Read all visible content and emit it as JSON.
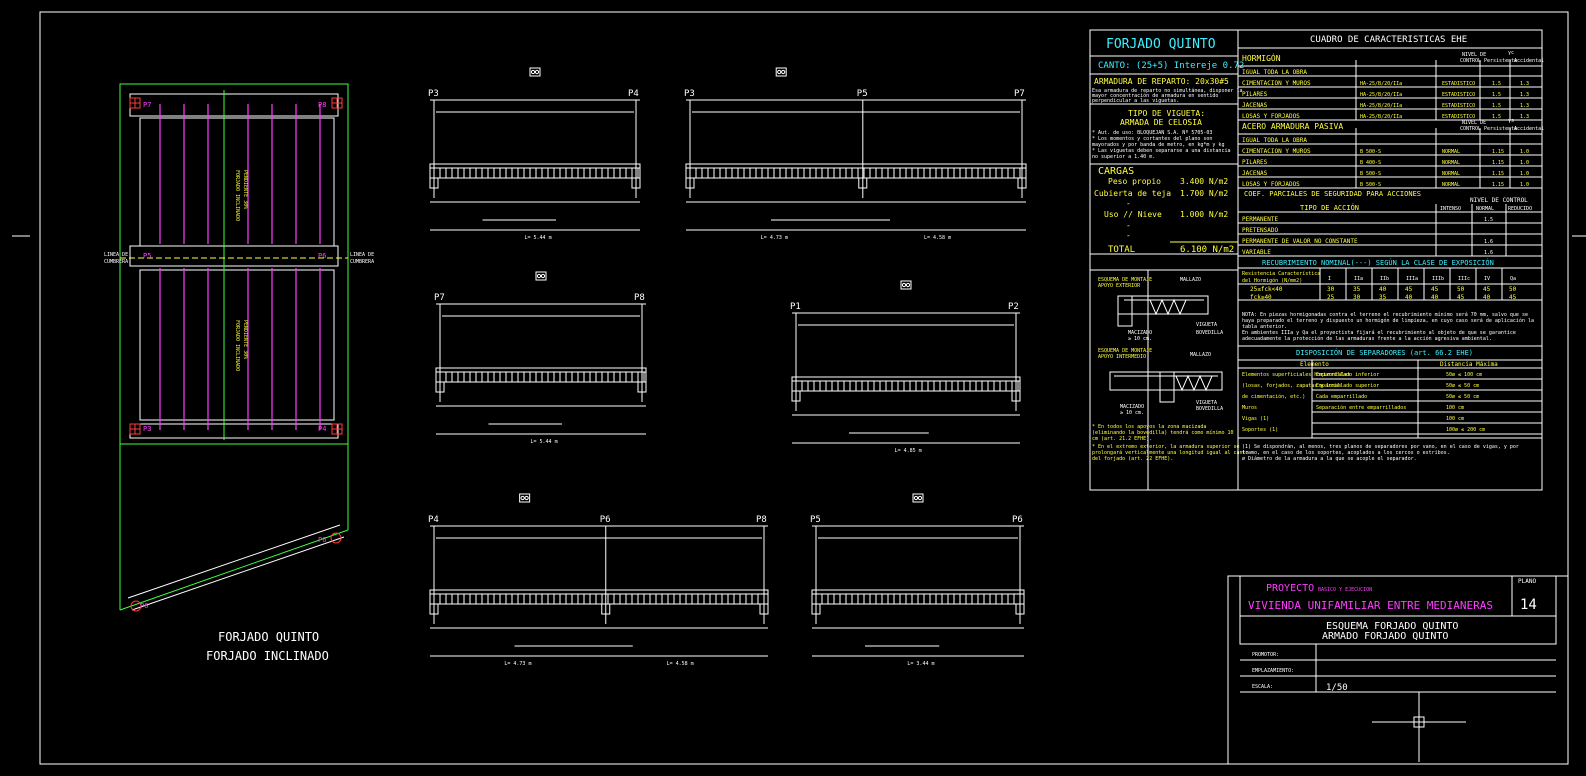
{
  "colors": {
    "background": "#000000",
    "frame": "#ffffff",
    "text_yellow": "#ffff3c",
    "text_cyan": "#3cf0ff",
    "text_magenta": "#ff3cff",
    "rebar": "#ff3cff",
    "outline": "#3cff3c",
    "marker": "#ff3c3c"
  },
  "plan": {
    "pillars": {
      "p7": "P7",
      "p8": "P8",
      "p5": "P5",
      "p6": "P6",
      "p3": "P3",
      "p4": "P4",
      "p6b": "P6",
      "p6c": "P6"
    },
    "side_left_top": "LINEA DE",
    "side_left_bottom": "CUMBRERA",
    "side_right_top": "LINEA DE",
    "side_right_bottom": "CUMBRERA",
    "label_top_bay": "FORJADO INCLINADO",
    "label_top_bay2": "PENDIENTE 30%",
    "label_bottom_bay": "FORJADO INCLINADO",
    "label_bottom_bay2": "PENDIENTE 30%",
    "title_line1": "FORJADO QUINTO",
    "title_line2": "FORJADO INCLINADO"
  },
  "beams": [
    {
      "id": "beam-p3-p4",
      "left": "P3",
      "right": "P4",
      "length": "L= 5.44 m"
    },
    {
      "id": "beam-p3-p5-p7",
      "left": "P3",
      "mid": "P5",
      "right": "P7",
      "length1": "L= 4.73 m",
      "length2": "L= 4.58 m"
    },
    {
      "id": "beam-p7-p8",
      "left": "P7",
      "right": "P8",
      "length": "L= 5.44 m"
    },
    {
      "id": "beam-p1-p2",
      "left": "P1",
      "right": "P2",
      "length": "L= 4.85 m"
    },
    {
      "id": "beam-p4-p6-p8",
      "left": "P4",
      "mid": "P6",
      "right": "P8",
      "length1": "L= 4.73 m",
      "length2": "L= 4.58 m"
    },
    {
      "id": "beam-p5-p6",
      "left": "P5",
      "right": "P6",
      "length": "L= 3.44 m"
    }
  ],
  "spec": {
    "title": "FORJADO QUINTO",
    "canto": "CANTO: (25+5) Intereje 0.72",
    "armadura": "ARMADURA DE REPARTO: 20x30#5",
    "armadura_note1": "Esa armadura de reparto no simultánea, disponer la",
    "armadura_note2": "mayor concentración de armadura en sentido",
    "armadura_note3": "perpendicular a las viguetas.",
    "vigueta_title1": "TIPO DE VIGUETA:",
    "vigueta_title2": "ARMADA DE CELOSIA",
    "vigueta_note1": "* Aut. de uso: BLOQUEJAN S.A. Nº 5705-03",
    "vigueta_note2": "* Los momentos y cortantes del plano son",
    "vigueta_note3": "mayorados y por banda de metro, en kg*m y kg",
    "vigueta_note4": "* Las viguetas deben separarse a una distancia",
    "vigueta_note5": "no superior a 1.40 m.",
    "cargas_title": "CARGAS",
    "cargas": [
      {
        "label": "Peso propio",
        "value": "3.400 N/m2"
      },
      {
        "label": "Cubierta de teja",
        "value": "1.700 N/m2"
      },
      {
        "label": "Uso // Nieve",
        "value": "1.000 N/m2"
      }
    ],
    "dash": "-",
    "total_label": "TOTAL",
    "total_value": "6.100 N/m2",
    "detail1_l1": "ESQUEMA DE MONTAJE",
    "detail1_l2": "APOYO EXTERIOR",
    "detail2_l1": "ESQUEMA DE MONTAJE",
    "detail2_l2": "APOYO INTERMEDIO",
    "detail_mallazo": "MALLAZO",
    "detail_vigueta": "VIGUETA",
    "detail_bovedilla": "BOVEDILLA",
    "detail_macizado": "MACIZADO",
    "detail_macizado_dim": "≥ 10 cm.",
    "detail_note1": "* En todos los apoyos la zona macizada",
    "detail_note2": "(eliminando la bovedilla) tendrá como mínimo 10",
    "detail_note3": "cm (art. 21.2 EFHE).",
    "detail_note4": "* En el extremo exterior, la armadura superior se",
    "detail_note5": "prolongará verticalmente una longitud igual al canto",
    "detail_note6": "del forjado (art. 22 EFHE)."
  },
  "characteristics": {
    "title": "CUADRO DE CARACTERISTICAS  EHE",
    "hormigon": "HORMIGÓN",
    "nivel": "NIVEL DE",
    "control": "CONTROL",
    "gamma": "γc",
    "persistente": "Persistente",
    "accidental": "Accidental",
    "igual_toda_obra": "IGUAL TODA LA OBRA",
    "horm_rows": [
      {
        "el": "CIMENTACION Y MUROS",
        "tipo": "HA-25/B/20/IIa",
        "nivel": "ESTADISTICO",
        "p": "1.5",
        "a": "1.3"
      },
      {
        "el": "PILARES",
        "tipo": "HA-25/B/20/IIa",
        "nivel": "ESTADISTICO",
        "p": "1.5",
        "a": "1.3"
      },
      {
        "el": "JACENAS",
        "tipo": "HA-25/B/20/IIa",
        "nivel": "ESTADISTICO",
        "p": "1.5",
        "a": "1.3"
      },
      {
        "el": "LOSAS Y FORJADOS",
        "tipo": "HA-25/B/20/IIa",
        "nivel": "ESTADISTICO",
        "p": "1.5",
        "a": "1.3"
      }
    ],
    "acero": "ACERO ARMADURA PASIVA",
    "gamma_s": "γs",
    "acero_rows": [
      {
        "el": "CIMENTACION Y MUROS",
        "tipo": "B 500-S",
        "nivel": "NORMAL",
        "p": "1.15",
        "a": "1.0"
      },
      {
        "el": "PILARES",
        "tipo": "B 400-S",
        "nivel": "NORMAL",
        "p": "1.15",
        "a": "1.0"
      },
      {
        "el": "JACENAS",
        "tipo": "B 500-S",
        "nivel": "NORMAL",
        "p": "1.15",
        "a": "1.0"
      },
      {
        "el": "LOSAS Y FORJADOS",
        "tipo": "B 500-S",
        "nivel": "NORMAL",
        "p": "1.15",
        "a": "1.0"
      }
    ],
    "coef_title": "COEF. PARCIALES DE SEGURIDAD PARA ACCIONES",
    "nivel_control": "NIVEL DE CONTROL",
    "tipo_accion": "TIPO DE ACCIÓN",
    "intenso": "INTENSO",
    "normal": "NORMAL",
    "reducido": "REDUCIDO",
    "acciones": [
      {
        "t": "PERMANENTE",
        "n": "1.5"
      },
      {
        "t": "PRETENSADO",
        "n": ""
      },
      {
        "t": "PERMANENTE DE VALOR NO CONSTANTE",
        "n": "1.6"
      },
      {
        "t": "VARIABLE",
        "n": "1.6"
      }
    ],
    "recub_title": "RECUBRIMIENTO NOMINAL(---) SEGÚN LA CLASE DE EXPOSICIÓN",
    "recub_h1": "Resistencia Característica",
    "recub_h2": "del Hormigón (N/mm2)",
    "recub_cols": [
      "I",
      "IIa",
      "IIb",
      "IIIa",
      "IIIb",
      "IIIc",
      "IV",
      "Qa"
    ],
    "recub_rows": [
      {
        "r": "25≤fck<40",
        "v": [
          "30",
          "35",
          "40",
          "45",
          "45",
          "50",
          "45",
          "50"
        ]
      },
      {
        "r": "fck≥40",
        "v": [
          "25",
          "30",
          "35",
          "40",
          "40",
          "45",
          "40",
          "45"
        ]
      }
    ],
    "recub_note1": "NOTA: En piezas hormigonadas contra el terreno el recubrimiento mínimo será 70 mm, salvo que se",
    "recub_note2": "haya preparado el terreno y dispuesto un hormigón de limpieza, en cuyo caso será de aplicación la",
    "recub_note3": "tabla anterior.",
    "recub_note4": "En ambientes IIIa y Qa el proyectista fijará el recubrimiento al objeto de que se garantice",
    "recub_note5": "adecuadamente la protección de las armaduras frente a la acción agresiva ambiental.",
    "sep_title": "DISPOSICIÓN DE SEPARADORES (art. 66.2 EHE)",
    "sep_elemento": "Elemento",
    "sep_dist": "Distancia Máxima",
    "sep_rows": [
      {
        "el": "Elementos superficiales horizontales",
        "sub": "Emparrillado inferior",
        "d": "50ø ≤ 100 cm"
      },
      {
        "el": "(losas, forjados, zapatas y losas",
        "sub": "Emparrillado superior",
        "d": "50ø ≤ 50 cm"
      },
      {
        "el": "de cimentación, etc.)",
        "sub": "Cada emparrillado",
        "d": "50ø ≤ 50 cm"
      },
      {
        "el": "Muros",
        "sub": "Separación entre emparrillados",
        "d": "100 cm"
      },
      {
        "el": "Vigas (1)",
        "sub": "",
        "d": "100 cm"
      },
      {
        "el": "Soportes (1)",
        "sub": "",
        "d": "100ø ≤ 200 cm"
      }
    ],
    "sep_note1": "(1) Se dispondrán, al menos, tres planos de separadores por vano, en el caso de vigas, y por",
    "sep_note2": "tramo, en el caso de los soportes, acoplados a los cercos o estribos.",
    "sep_note3": "ø Diámetro de la armadura a la que se acople el separador."
  },
  "titleblock": {
    "proyecto_label": "PROYECTO",
    "proyecto_sub": "BASICO Y EJECUCION",
    "proyecto_name": "VIVIENDA UNIFAMILIAR ENTRE MEDIANERAS",
    "plano_label": "PLANO",
    "plano_num": "14",
    "esquema1": "ESQUEMA FORJADO QUINTO",
    "esquema2": "ARMADO FORJADO QUINTO",
    "promotor": "PROMOTOR:",
    "emplazamiento": "EMPLAZAMIENTO:",
    "escala": "ESCALA:",
    "escala_value": "1/50"
  }
}
